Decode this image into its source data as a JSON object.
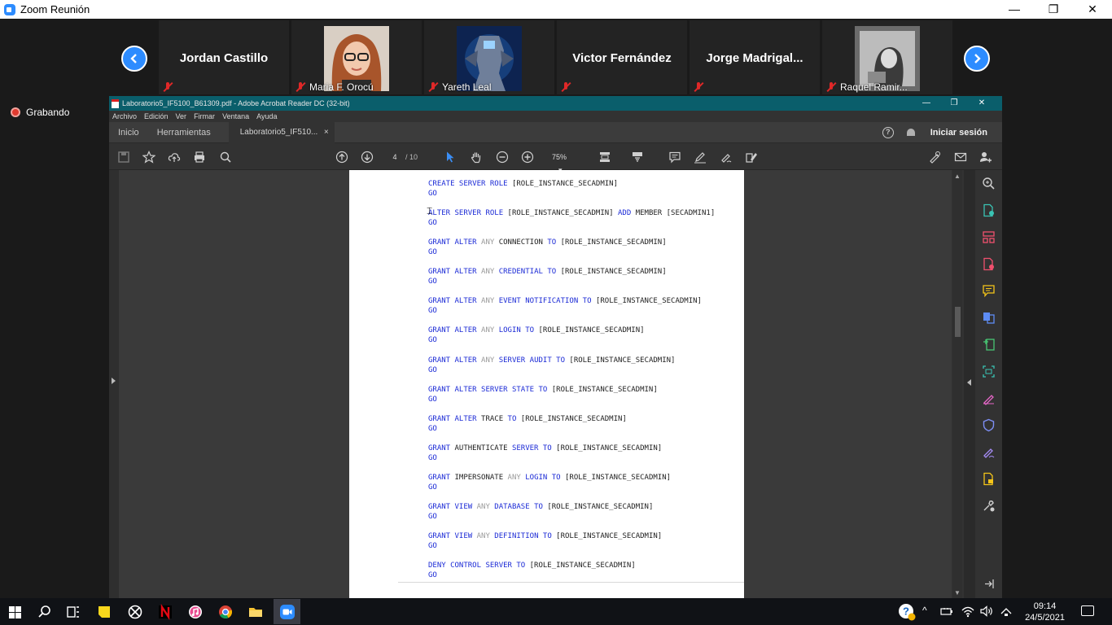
{
  "zoom": {
    "title": "Zoom Reunión",
    "window_controls": [
      "—",
      "❐",
      "✕"
    ],
    "recording_label": "Grabando",
    "participants": [
      {
        "name": "Jordan Castillo",
        "muted": true
      },
      {
        "name": "Maria F. Orocú",
        "muted": true,
        "has_video": true
      },
      {
        "name": "Yareth Leal",
        "muted": true,
        "has_video": true
      },
      {
        "name": "Victor Fernández",
        "muted": true
      },
      {
        "name": "Jorge  Madrigal...",
        "muted": true
      },
      {
        "name": "Raquel Ramir...",
        "muted": true,
        "has_video": true
      }
    ],
    "prev_icon": "chevron-left-icon",
    "next_icon": "chevron-right-icon"
  },
  "acrobat": {
    "title": "Laboratorio5_IF5100_B61309.pdf - Adobe Acrobat Reader DC (32-bit)",
    "menu": [
      "Archivo",
      "Edición",
      "Ver",
      "Firmar",
      "Ventana",
      "Ayuda"
    ],
    "tabs": {
      "home": "Inicio",
      "tools": "Herramientas",
      "document": "Laboratorio5_IF510...",
      "close": "×"
    },
    "signin": "Iniciar sesión",
    "page_current": "4",
    "page_total": "/ 10",
    "zoom_level": "75%",
    "zoom_caret": "▾"
  },
  "document": {
    "lines": [
      {
        "l1": [
          {
            "t": "CREATE SERVER ROLE",
            "c": "kw"
          },
          {
            "t": " [ROLE_INSTANCE_SECADMIN]",
            "c": "tx"
          }
        ]
      },
      {
        "l1": [
          {
            "t": "ALTER SERVER ROLE",
            "c": "kw"
          },
          {
            "t": " [ROLE_INSTANCE_SECADMIN] ",
            "c": "tx"
          },
          {
            "t": "ADD",
            "c": "kw"
          },
          {
            "t": " MEMBER [SECADMIN1]",
            "c": "tx"
          }
        ]
      },
      {
        "l1": [
          {
            "t": "GRANT ALTER ",
            "c": "kw"
          },
          {
            "t": "ANY",
            "c": "gr"
          },
          {
            "t": " CONNECTION ",
            "c": "tx"
          },
          {
            "t": "TO",
            "c": "kw"
          },
          {
            "t": " [ROLE_INSTANCE_SECADMIN]",
            "c": "tx"
          }
        ]
      },
      {
        "l1": [
          {
            "t": "GRANT ALTER ",
            "c": "kw"
          },
          {
            "t": "ANY",
            "c": "gr"
          },
          {
            "t": " ",
            "c": "tx"
          },
          {
            "t": "CREDENTIAL TO",
            "c": "kw"
          },
          {
            "t": " [ROLE_INSTANCE_SECADMIN]",
            "c": "tx"
          }
        ]
      },
      {
        "l1": [
          {
            "t": "GRANT ALTER ",
            "c": "kw"
          },
          {
            "t": "ANY",
            "c": "gr"
          },
          {
            "t": " ",
            "c": "tx"
          },
          {
            "t": "EVENT NOTIFICATION TO",
            "c": "kw"
          },
          {
            "t": " [ROLE_INSTANCE_SECADMIN]",
            "c": "tx"
          }
        ]
      },
      {
        "l1": [
          {
            "t": "GRANT ALTER ",
            "c": "kw"
          },
          {
            "t": "ANY",
            "c": "gr"
          },
          {
            "t": " ",
            "c": "tx"
          },
          {
            "t": "LOGIN TO",
            "c": "kw"
          },
          {
            "t": " [ROLE_INSTANCE_SECADMIN]",
            "c": "tx"
          }
        ]
      },
      {
        "l1": [
          {
            "t": "GRANT ALTER ",
            "c": "kw"
          },
          {
            "t": "ANY",
            "c": "gr"
          },
          {
            "t": " ",
            "c": "tx"
          },
          {
            "t": "SERVER AUDIT TO",
            "c": "kw"
          },
          {
            "t": " [ROLE_INSTANCE_SECADMIN]",
            "c": "tx"
          }
        ]
      },
      {
        "l1": [
          {
            "t": "GRANT ALTER SERVER STATE TO",
            "c": "kw"
          },
          {
            "t": " [ROLE_INSTANCE_SECADMIN]",
            "c": "tx"
          }
        ]
      },
      {
        "l1": [
          {
            "t": "GRANT ALTER",
            "c": "kw"
          },
          {
            "t": " TRACE ",
            "c": "tx"
          },
          {
            "t": "TO",
            "c": "kw"
          },
          {
            "t": " [ROLE_INSTANCE_SECADMIN]",
            "c": "tx"
          }
        ]
      },
      {
        "l1": [
          {
            "t": "GRANT",
            "c": "kw"
          },
          {
            "t": " AUTHENTICATE ",
            "c": "tx"
          },
          {
            "t": "SERVER TO",
            "c": "kw"
          },
          {
            "t": " [ROLE_INSTANCE_SECADMIN]",
            "c": "tx"
          }
        ]
      },
      {
        "l1": [
          {
            "t": "GRANT",
            "c": "kw"
          },
          {
            "t": " IMPERSONATE ",
            "c": "tx"
          },
          {
            "t": "ANY",
            "c": "gr"
          },
          {
            "t": " ",
            "c": "tx"
          },
          {
            "t": "LOGIN TO",
            "c": "kw"
          },
          {
            "t": " [ROLE_INSTANCE_SECADMIN]",
            "c": "tx"
          }
        ]
      },
      {
        "l1": [
          {
            "t": "GRANT VIEW ",
            "c": "kw"
          },
          {
            "t": "ANY",
            "c": "gr"
          },
          {
            "t": " ",
            "c": "tx"
          },
          {
            "t": "DATABASE TO",
            "c": "kw"
          },
          {
            "t": " [ROLE_INSTANCE_SECADMIN]",
            "c": "tx"
          }
        ]
      },
      {
        "l1": [
          {
            "t": "GRANT VIEW ",
            "c": "kw"
          },
          {
            "t": "ANY",
            "c": "gr"
          },
          {
            "t": " ",
            "c": "tx"
          },
          {
            "t": "DEFINITION TO",
            "c": "kw"
          },
          {
            "t": " [ROLE_INSTANCE_SECADMIN]",
            "c": "tx"
          }
        ]
      },
      {
        "l1": [
          {
            "t": "DENY CONTROL SERVER TO",
            "c": "kw"
          },
          {
            "t": " [ROLE_INSTANCE_SECADMIN]",
            "c": "tx"
          }
        ]
      }
    ],
    "go": "GO"
  },
  "taskbar": {
    "time": "09:14",
    "date": "24/5/2021",
    "apps": [
      "start-icon",
      "search-icon",
      "task-view-icon",
      "sticky-notes-icon",
      "xbox-icon",
      "netflix-icon",
      "itunes-icon",
      "chrome-icon",
      "file-explorer-icon",
      "zoom-icon"
    ]
  },
  "colors": {
    "keyword": "#1c2bd6",
    "zoom_blue": "#2d8cff",
    "acrobat_titlebar": "#0a5e6b",
    "mute_red": "#e02828"
  }
}
